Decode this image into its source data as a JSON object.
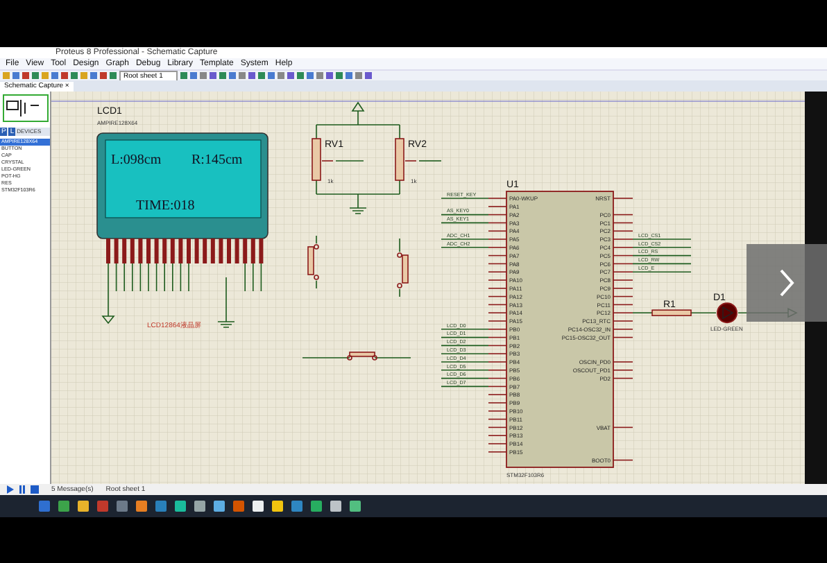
{
  "window": {
    "title": "Proteus 8 Professional - Schematic Capture"
  },
  "menu": [
    "File",
    "View",
    "Tool",
    "Design",
    "Graph",
    "Debug",
    "Library",
    "Template",
    "System",
    "Help"
  ],
  "toolbar": {
    "sheet_dropdown": "Root sheet 1"
  },
  "tabs": [
    {
      "label": "Schematic Capture",
      "selected": true,
      "close": "×"
    }
  ],
  "device_list": {
    "mode_buttons": [
      "P",
      "L"
    ],
    "heading": "DEVICES",
    "items": [
      {
        "label": "AMPIRE128X64",
        "selected": true
      },
      {
        "label": "BUTTON",
        "selected": false
      },
      {
        "label": "CAP",
        "selected": false
      },
      {
        "label": "CRYSTAL",
        "selected": false
      },
      {
        "label": "LED-GREEN",
        "selected": false
      },
      {
        "label": "POT-HG",
        "selected": false
      },
      {
        "label": "RES",
        "selected": false
      },
      {
        "label": "STM32F103R6",
        "selected": false
      }
    ]
  },
  "schematic": {
    "lcd": {
      "ref": "LCD1",
      "part": "AMPIRE128X64",
      "line_1_left": "L:098cm",
      "line_1_right": "R:145cm",
      "line_2": "TIME:018",
      "caption": "LCD12864液晶屏"
    },
    "pots": [
      {
        "ref": "RV1",
        "value": "1k"
      },
      {
        "ref": "RV2",
        "value": "1k"
      }
    ],
    "mcu": {
      "ref": "U1",
      "part": "STM32F103R6",
      "left_pins": [
        "PA0-WKUP",
        "PA1",
        "PA2",
        "PA3",
        "PA4",
        "PA5",
        "PA6",
        "PA7",
        "PA8",
        "PA9",
        "PA10",
        "PA11",
        "PA12",
        "PA13",
        "PA14",
        "PA15",
        "PB0",
        "PB1",
        "PB2",
        "PB3",
        "PB4",
        "PB5",
        "PB6",
        "PB7",
        "PB8",
        "PB9",
        "PB10",
        "PB11",
        "PB12",
        "PB13",
        "PB14",
        "PB15"
      ],
      "right_pins": [
        "NRST",
        "PC0",
        "PC1",
        "PC2",
        "PC3",
        "PC4",
        "PC5",
        "PC6",
        "PC7",
        "PC8",
        "PC9",
        "PC10",
        "PC11",
        "PC12",
        "PC13_RTC",
        "PC14-OSC32_IN",
        "PC15-OSC32_OUT",
        "OSCIN_PD0",
        "OSCOUT_PD1",
        "PD2",
        "VBAT",
        "BOOT0"
      ]
    },
    "left_nets": [
      "RESET_KEY",
      "AS_KEY0",
      "AS_KEY1",
      "ADC_CH1",
      "ADC_CH2",
      "LCD_D0",
      "LCD_D1",
      "LCD_D2",
      "LCD_D3",
      "LCD_D4",
      "LCD_D5",
      "LCD_D6",
      "LCD_D7"
    ],
    "right_nets": [
      "LCD_CS1",
      "LCD_CS2",
      "LCD_RS",
      "LCD_RW",
      "LCD_E"
    ],
    "resistor": {
      "ref": "R1"
    },
    "led": {
      "ref": "D1",
      "part": "LED-GREEN"
    }
  },
  "status_bar": {
    "messages": "5 Message(s)",
    "sheet": "Root sheet 1"
  }
}
